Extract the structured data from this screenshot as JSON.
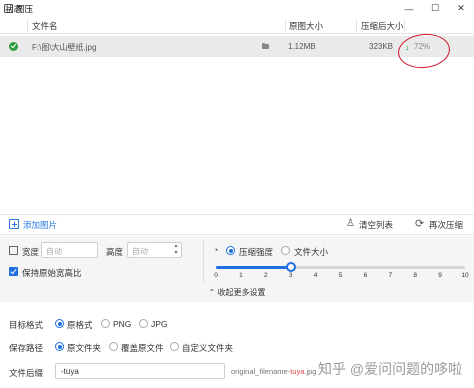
{
  "window": {
    "title": "图压",
    "min_glyph": "—",
    "max_glyph": "☐",
    "close_glyph": "✕"
  },
  "table": {
    "headers": [
      "状态",
      "文件名",
      "原图大小",
      "压缩后大小"
    ],
    "rows": [
      {
        "status_icon": "check-circle-icon",
        "file_path": "F:\\图\\大山壁纸.jpg",
        "original_size": "1.12MB",
        "compressed_size": "323KB",
        "reduction_arrow": "↓",
        "reduction": "72%"
      }
    ]
  },
  "annotation": {
    "color": "#d0162b"
  },
  "actions": {
    "add_images": "添加图片",
    "clear_list": "清空列表",
    "recompress": "再次压缩"
  },
  "settings": {
    "width_label": "宽度",
    "width_placeholder": "自动",
    "height_label": "高度",
    "height_placeholder": "自动",
    "keep_ratio_label": "保持原始宽高比",
    "keep_ratio_checked": true,
    "mode_options": [
      "压缩强度",
      "文件大小"
    ],
    "mode_selected": "压缩强度",
    "strength": {
      "value": 3,
      "min": 0,
      "max": 10,
      "ticks": [
        "0",
        "1",
        "2",
        "3",
        "4",
        "5",
        "6",
        "7",
        "8",
        "9",
        "10"
      ]
    },
    "collapse_label": "⌃ 收起更多设置"
  },
  "output": {
    "format_label": "目标格式",
    "format_options": [
      "原格式",
      "PNG",
      "JPG"
    ],
    "format_selected": "原格式",
    "save_path_label": "保存路径",
    "save_path_options": [
      "原文件夹",
      "覆盖原文件",
      "自定义文件夹"
    ],
    "save_path_selected": "原文件夹",
    "suffix_label": "文件后缀",
    "suffix_value": "-tuya",
    "preview_prefix": "original_filename-",
    "preview_highlight": "tuya",
    "preview_suffix": ".jpg"
  },
  "watermark": {
    "text": "知乎 @爱问问题的哆啦"
  },
  "colors": {
    "accent": "#1f6fe0",
    "success": "#2e9e3e",
    "row_selected": "#eaeaea"
  }
}
